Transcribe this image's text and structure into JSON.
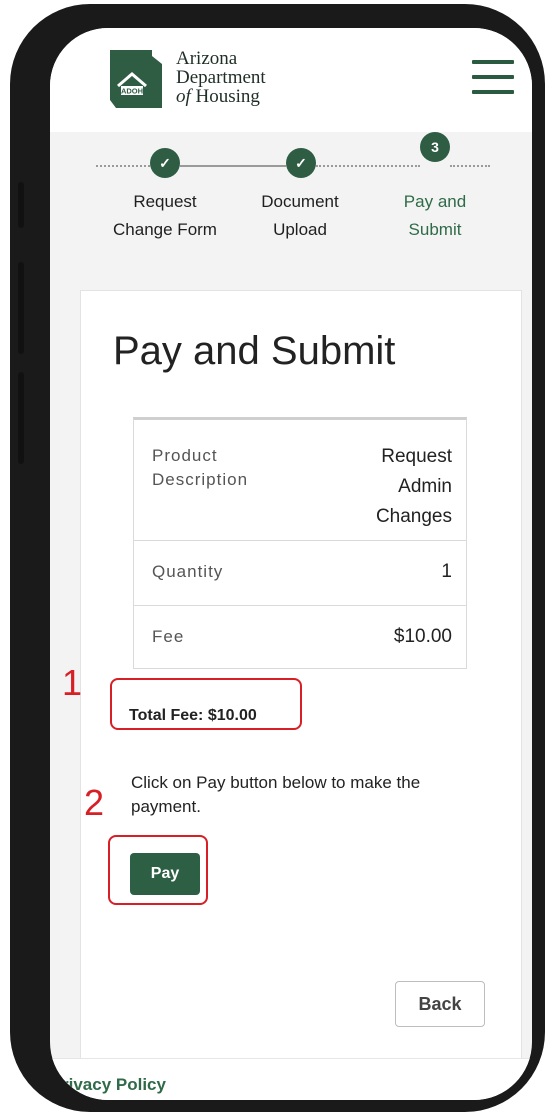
{
  "header": {
    "logo_badge": "ADOH",
    "logo_line1": "Arizona",
    "logo_line2": "Department",
    "logo_line3_prefix": "of",
    "logo_line3_rest": " Housing",
    "menu_icon": "hamburger-menu-icon"
  },
  "stepper": {
    "steps": [
      {
        "marker": "✓",
        "label1": "Request",
        "label2": "Change Form",
        "state": "done"
      },
      {
        "marker": "✓",
        "label1": "Document",
        "label2": "Upload",
        "state": "done"
      },
      {
        "marker": "3",
        "label1": "Pay and",
        "label2": "Submit",
        "state": "active"
      }
    ]
  },
  "main": {
    "title": "Pay and Submit",
    "table": {
      "product_label_1": "Product",
      "product_label_2": "Description",
      "product_value_1": "Request",
      "product_value_2": "Admin",
      "product_value_3": "Changes",
      "quantity_label": "Quantity",
      "quantity_value": "1",
      "fee_label": "Fee",
      "fee_value": "$10.00"
    },
    "total_fee": "Total Fee: $10.00",
    "instruction": "Click on Pay button below to make the payment.",
    "pay_label": "Pay",
    "back_label": "Back"
  },
  "annotations": {
    "marker_1": "1",
    "marker_2": "2",
    "highlight_color": "#d71f26"
  },
  "footer": {
    "privacy_label": "rivacy Policy"
  },
  "colors": {
    "brand_green": "#2f5d44",
    "active_step_text": "#2f6b48"
  }
}
